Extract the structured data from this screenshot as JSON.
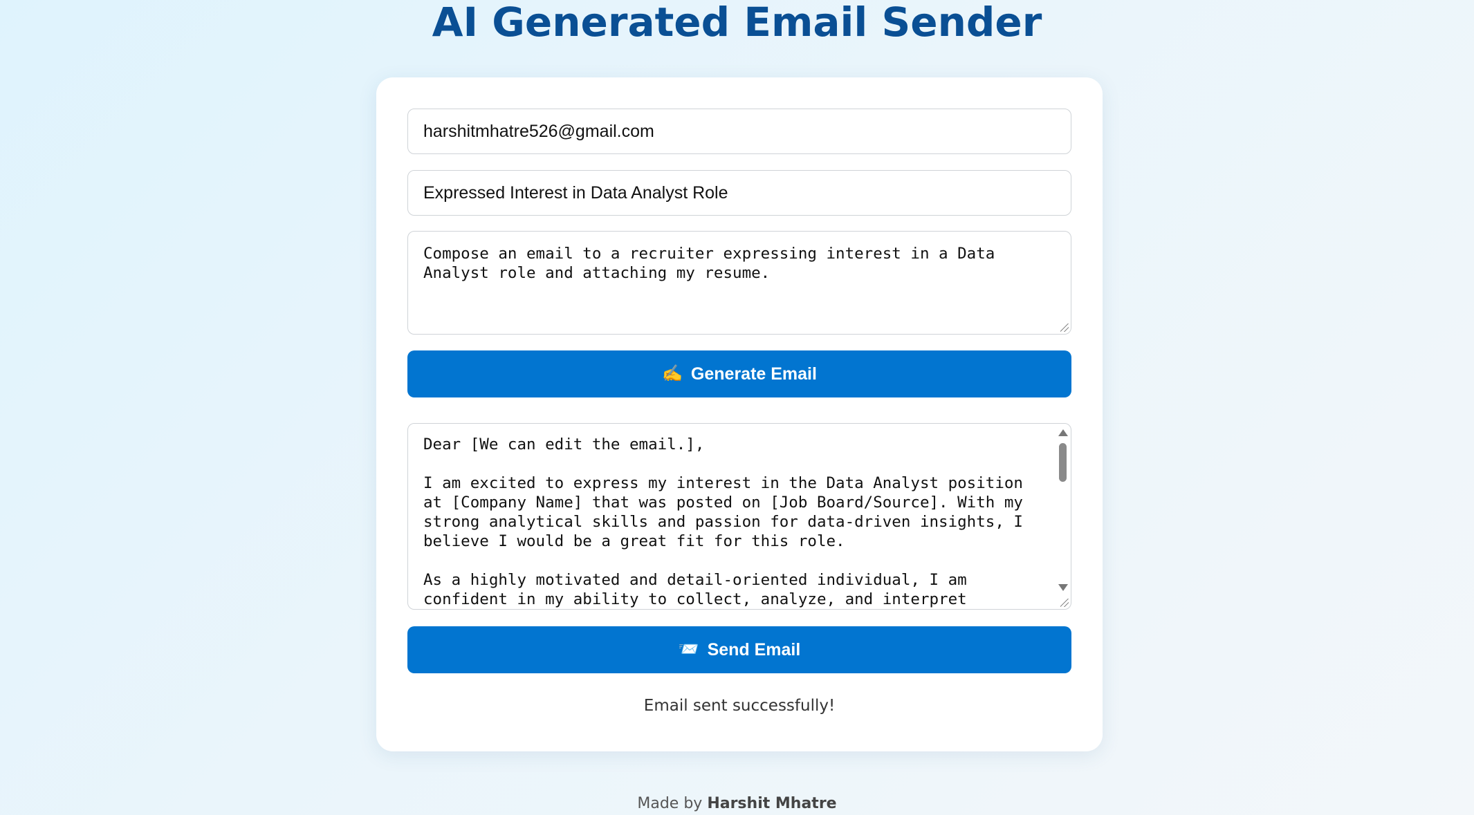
{
  "header": {
    "title": "AI Generated Email Sender"
  },
  "form": {
    "recipient_value": "harshitmhatre526@gmail.com",
    "subject_value": "Expressed Interest in Data Analyst Role",
    "prompt_value": "Compose an email to a recruiter expressing interest in a Data Analyst role and attaching my resume.",
    "generate_button": {
      "label": "Generate Email",
      "icon": "writing-hand-icon",
      "glyph": "✍️"
    },
    "generated_email_value": "Dear [We can edit the email.],\n\nI am excited to express my interest in the Data Analyst position at [Company Name] that was posted on [Job Board/Source]. With my strong analytical skills and passion for data-driven insights, I believe I would be a great fit for this role.\n\nAs a highly motivated and detail-oriented individual, I am confident in my ability to collect, analyze, and interpret complex",
    "send_button": {
      "label": "Send Email",
      "icon": "send-email-icon",
      "glyph": "📨"
    },
    "status_message": "Email sent successfully!"
  },
  "footer": {
    "prefix": "Made by",
    "author": "Harshit Mhatre"
  },
  "colors": {
    "title": "#0a4f94",
    "button": "#0275d0",
    "card": "#ffffff"
  }
}
